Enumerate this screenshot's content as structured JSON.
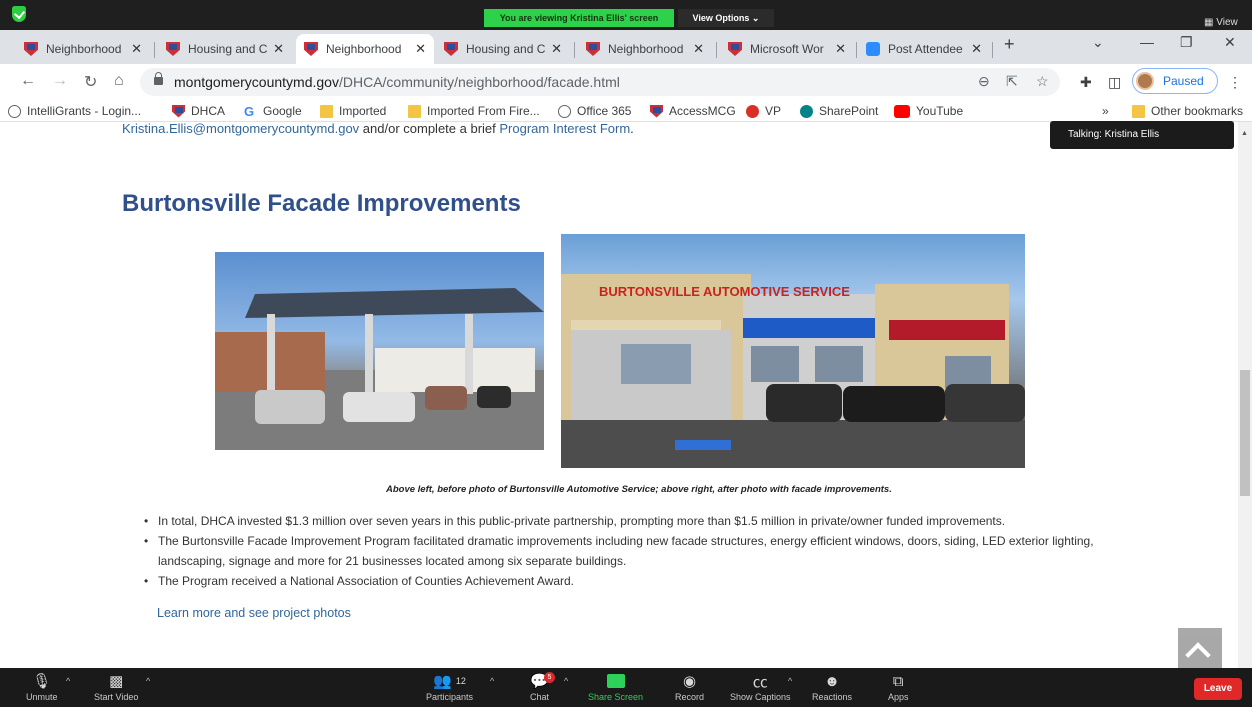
{
  "zoom": {
    "viewing_banner": "You are viewing Kristina Ellis' screen",
    "view_options": "View Options ⌄",
    "view_label": "View",
    "talking": "Talking: Kristina Ellis",
    "toolbar": {
      "unmute": "Unmute",
      "start_video": "Start Video",
      "participants": "Participants",
      "participants_count": "12",
      "chat": "Chat",
      "chat_badge": "5",
      "share_screen": "Share Screen",
      "record": "Record",
      "show_captions": "Show Captions",
      "reactions": "Reactions",
      "apps": "Apps",
      "leave": "Leave"
    }
  },
  "browser": {
    "tabs": [
      {
        "label": "Neighborhood",
        "icon": "dhca-shield-icon"
      },
      {
        "label": "Housing and C",
        "icon": "dhca-shield-icon"
      },
      {
        "label": "Neighborhood",
        "icon": "dhca-shield-icon",
        "active": true
      },
      {
        "label": "Housing and C",
        "icon": "dhca-shield-icon"
      },
      {
        "label": "Neighborhood",
        "icon": "dhca-shield-icon"
      },
      {
        "label": "Microsoft Wor",
        "icon": "dhca-shield-icon"
      },
      {
        "label": "Post Attendee",
        "icon": "zoom-icon"
      }
    ],
    "url_host": "montgomerycountymd.gov",
    "url_path": "/DHCA/community/neighborhood/facade.html",
    "profile_label": "Paused",
    "bookmarks": [
      {
        "label": "IntelliGrants - Login...",
        "icon": "globe-icon"
      },
      {
        "label": "DHCA",
        "icon": "dhca-shield-icon"
      },
      {
        "label": "Google",
        "icon": "google-icon"
      },
      {
        "label": "Imported",
        "icon": "folder-icon"
      },
      {
        "label": "Imported From Fire...",
        "icon": "folder-icon"
      },
      {
        "label": "Office 365",
        "icon": "globe-icon"
      },
      {
        "label": "AccessMCG",
        "icon": "dhca-shield-icon"
      },
      {
        "label": "VP",
        "icon": "vp-icon"
      },
      {
        "label": "SharePoint",
        "icon": "sharepoint-icon"
      },
      {
        "label": "YouTube",
        "icon": "youtube-icon"
      }
    ],
    "bookmarks_overflow": "»",
    "other_bookmarks": "Other bookmarks"
  },
  "page": {
    "intro_email": "Kristina.Ellis@montgomerycountymd.gov",
    "intro_mid": " and/or complete a brief ",
    "intro_link": "Program Interest Form",
    "intro_end": ".",
    "heading": "Burtonsville Facade Improvements",
    "sign_text": "BURTONSVILLE AUTOMOTIVE SERVICE",
    "caption": "Above left, before photo of Burtonsville Automotive Service; above right, after photo with facade improvements.",
    "bullets": [
      "In total, DHCA invested $1.3 million over seven years in this public-private partnership, prompting more than $1.5 million in private/owner funded improvements.",
      "The Burtonsville Facade Improvement Program facilitated dramatic improvements including new facade structures, energy efficient windows, doors, siding, LED exterior lighting, landscaping, signage and more for 21 businesses located among six separate buildings.",
      "The Program received a National Association of Counties Achievement Award."
    ],
    "learn_more": "Learn more and see project photos"
  }
}
